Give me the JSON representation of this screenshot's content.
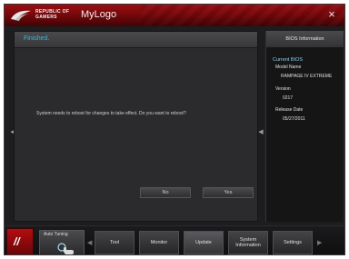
{
  "window": {
    "brand": "REPUBLIC OF GAMERS",
    "title": "MyLogo",
    "close_symbol": "×"
  },
  "main": {
    "status": "Finished.",
    "message": "System needs to reboot for changes to take effect. Do you want to reboot?",
    "no_label": "No",
    "yes_label": "Yes"
  },
  "info": {
    "header": "BIOS Information",
    "current_bios_label": "Current BIOS",
    "model_name_label": "Model Name",
    "model_name_value": "RAMPAGE IV EXTREME",
    "version_label": "Version",
    "version_value": "0217",
    "release_date_label": "Release Date",
    "release_date_value": "05/27/2011"
  },
  "toolbar": {
    "auto_tuning_label": "Auto Tuning",
    "tabs": [
      {
        "label": "Tool"
      },
      {
        "label": "Monitor"
      },
      {
        "label": "Update"
      },
      {
        "label": "System Information"
      },
      {
        "label": "Settings"
      }
    ]
  },
  "colors": {
    "accent_red": "#9a0e12",
    "status_blue": "#2fb8e6",
    "label_blue": "#8fd0ee"
  }
}
